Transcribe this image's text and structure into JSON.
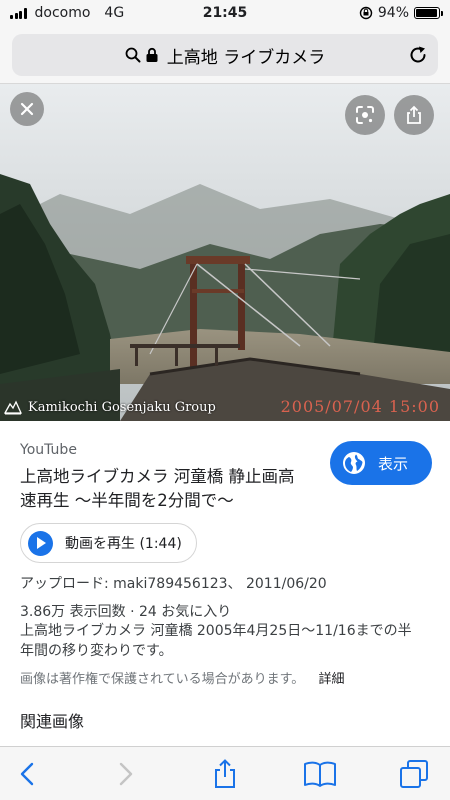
{
  "status_bar": {
    "carrier": "docomo",
    "network": "4G",
    "time": "21:45",
    "battery_percent": "94%",
    "battery_level": 0.94
  },
  "browser": {
    "url_title": "上高地 ライブカメラ"
  },
  "viewer": {
    "watermark_logo": "Kamikochi Gosenjaku Group",
    "timestamp_overlay": "2005/07/04 15:00"
  },
  "result": {
    "source": "YouTube",
    "title": "上高地ライブカメラ 河童橋 静止画高速再生 〜半年間を2分間で〜",
    "visit_label": "表示",
    "play_label": "動画を再生 (1:44)",
    "upload_line": "アップロード: maki789456123、 2011/06/20",
    "stats_line": "3.86万 表示回数 · 24 お気に入り",
    "description": "上高地ライブカメラ 河童橋 2005年4月25日〜11/16までの半年間の移り変わりです。",
    "copyright_notice": "画像は著作権で保護されている場合があります。",
    "details_link": "詳細",
    "related_heading": "関連画像"
  },
  "colors": {
    "accent": "#1a73e8",
    "timestamp": "#d9624f"
  },
  "icons": {
    "close": "close-icon",
    "lens": "lens-icon",
    "share": "share-icon",
    "globe": "globe-icon",
    "play": "play-icon",
    "back": "back-icon",
    "forward": "forward-icon",
    "bookmarks": "bookmarks-icon",
    "tabs": "tabs-icon"
  }
}
